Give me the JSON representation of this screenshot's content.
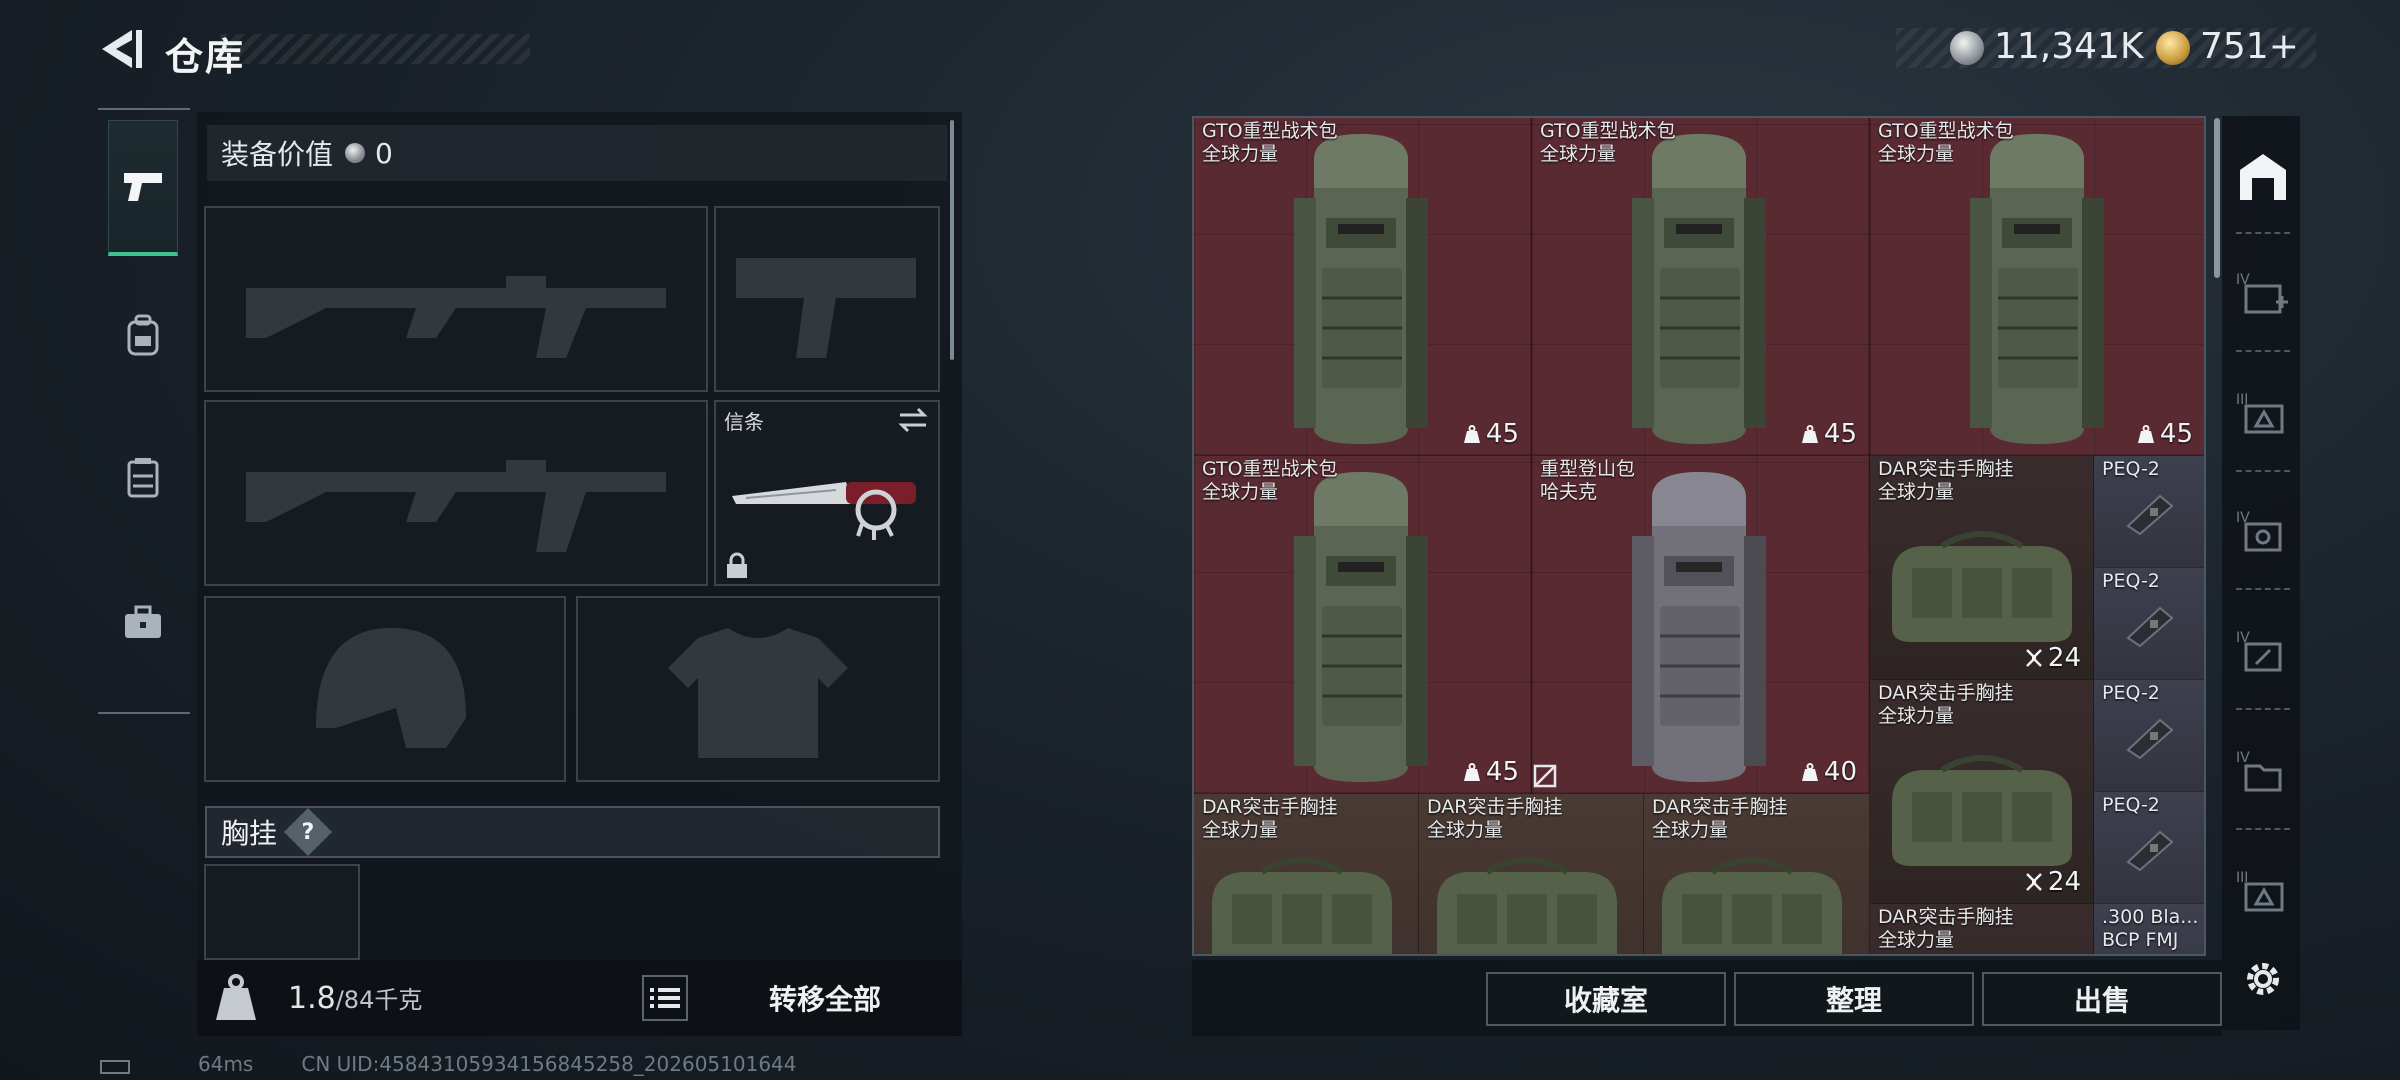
{
  "header": {
    "title": "仓库",
    "currency": [
      {
        "icon": "silver-coin-icon",
        "value": "11,341K"
      },
      {
        "icon": "gold-coin-icon",
        "value": "751+"
      }
    ]
  },
  "left": {
    "categories": [
      "weapon-icon",
      "backpack-icon",
      "chest-rig-icon",
      "case-icon"
    ],
    "equip_value_label": "装备价值",
    "equip_value": "0",
    "melee_slot_label": "信条",
    "chest_rig_label": "胸挂",
    "chest_rig_help": "?",
    "weight_current": "1.8",
    "weight_max": "/84千克",
    "transfer_all": "转移全部"
  },
  "grid": {
    "items": [
      {
        "name": "GTO重型战术包",
        "sub": "全球力量",
        "count": "45"
      },
      {
        "name": "GTO重型战术包",
        "sub": "全球力量",
        "count": "45"
      },
      {
        "name": "GTO重型战术包",
        "sub": "全球力量",
        "count": "45"
      },
      {
        "name": "GTO重型战术包",
        "sub": "全球力量",
        "count": "45"
      },
      {
        "name": "重型登山包",
        "sub": "哈夫克",
        "count": "40"
      },
      {
        "name": "DAR突击手胸挂",
        "sub": "全球力量",
        "count": "24"
      },
      {
        "name": "PEQ-2"
      },
      {
        "name": "PEQ-2"
      },
      {
        "name": "DAR突击手胸挂",
        "sub": "全球力量",
        "count": "24"
      },
      {
        "name": "PEQ-2"
      },
      {
        "name": "PEQ-2"
      },
      {
        "name": "DAR突击手胸挂",
        "sub": "全球力量"
      },
      {
        "name": "DAR突击手胸挂",
        "sub": "全球力量"
      },
      {
        "name": "DAR突击手胸挂",
        "sub": "全球力量"
      },
      {
        "name": "DAR突击手胸挂",
        "sub": "全球力量"
      },
      {
        "name": ".300 Bla...",
        "sub": "BCP FMJ"
      }
    ]
  },
  "actions": {
    "collection": "收藏室",
    "sort": "整理",
    "sell": "出售"
  },
  "status": {
    "ping": "64ms",
    "uid": "CN UID:45843105934156845258_202605101644"
  }
}
